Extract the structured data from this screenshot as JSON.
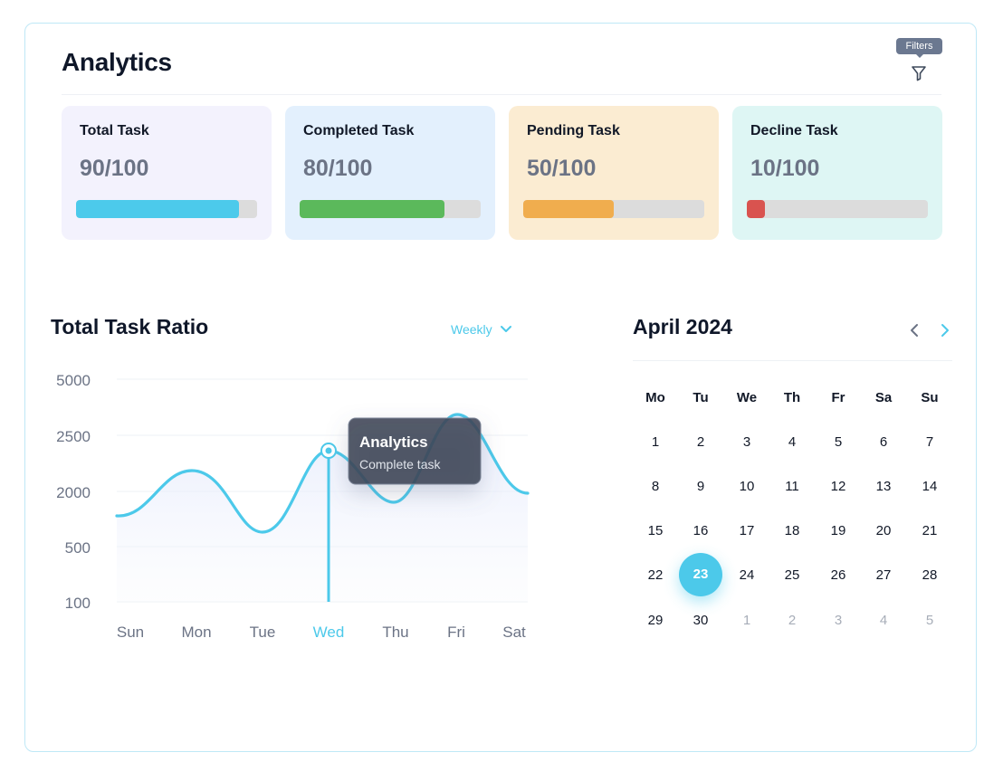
{
  "header": {
    "title": "Analytics",
    "filters_tooltip": "Filters",
    "filter_icon": "filter-icon"
  },
  "cards": [
    {
      "label": "Total Task",
      "value": "90/100",
      "progress": 0.9,
      "bg": "#f3f2fd",
      "color": "#4ccaeb"
    },
    {
      "label": "Completed Task",
      "value": "80/100",
      "progress": 0.8,
      "bg": "#e3f0fd",
      "color": "#5bb95b"
    },
    {
      "label": "Pending Task",
      "value": "50/100",
      "progress": 0.5,
      "bg": "#fbecd2",
      "color": "#f0ad4e"
    },
    {
      "label": "Decline Task",
      "value": "10/100",
      "progress": 0.1,
      "bg": "#def6f4",
      "color": "#d9534f"
    }
  ],
  "ratio": {
    "title": "Total Task Ratio",
    "period": "Weekly",
    "tooltip": {
      "title": "Analytics",
      "subtitle": "Complete task"
    }
  },
  "chart_data": {
    "type": "line",
    "categories": [
      "Sun",
      "Mon",
      "Tue",
      "Wed",
      "Thu",
      "Fri",
      "Sat"
    ],
    "y_ticks": [
      "5000",
      "2500",
      "2000",
      "500",
      "100"
    ],
    "highlighted_category": "Wed",
    "highlight_color": "#4cc9ea",
    "line_color": "#4cc9ea"
  },
  "calendar": {
    "title": "April 2024",
    "weekdays": [
      "Mo",
      "Tu",
      "We",
      "Th",
      "Fr",
      "Sa",
      "Su"
    ],
    "selected_day": "23",
    "weeks": [
      [
        "1",
        "2",
        "3",
        "4",
        "5",
        "6",
        "7"
      ],
      [
        "8",
        "9",
        "10",
        "11",
        "12",
        "13",
        "14"
      ],
      [
        "15",
        "16",
        "17",
        "18",
        "19",
        "20",
        "21"
      ],
      [
        "22",
        "23",
        "24",
        "25",
        "26",
        "27",
        "28"
      ],
      [
        "29",
        "30",
        "1",
        "2",
        "3",
        "4",
        "5"
      ]
    ],
    "muted_from": {
      "week": 4,
      "index": 2
    },
    "prev_icon": "chevron-left-icon",
    "next_icon": "chevron-right-icon"
  }
}
